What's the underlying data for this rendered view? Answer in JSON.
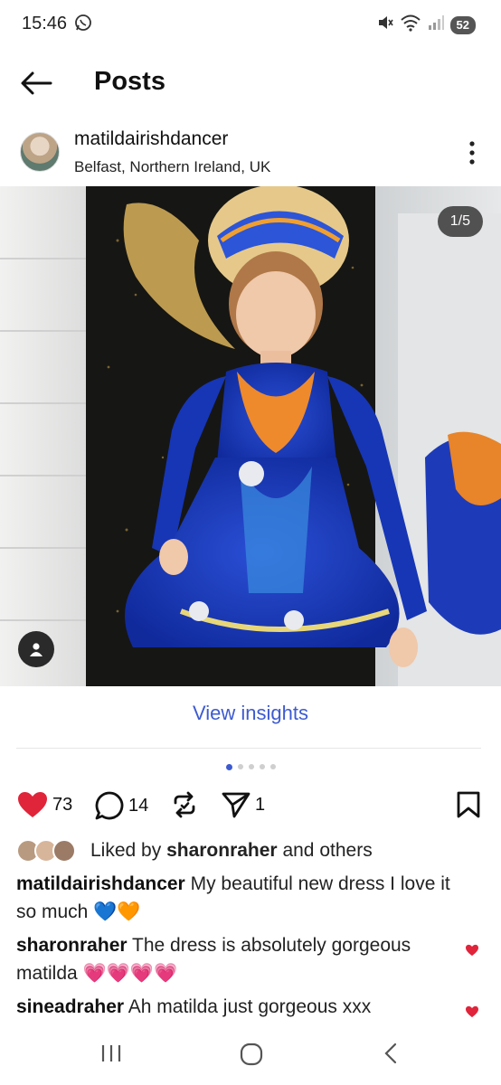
{
  "status": {
    "time": "15:46",
    "battery": "52"
  },
  "topbar": {
    "title": "Posts"
  },
  "post": {
    "username": "matildairishdancer",
    "location": "Belfast, Northern Ireland, UK",
    "image_counter": "1/5",
    "view_insights": "View insights",
    "pages": 5,
    "active_page": 1
  },
  "actions": {
    "likes": "73",
    "comments": "14",
    "shares": "1"
  },
  "liked_by": {
    "prefix": "Liked by ",
    "user": "sharonraher",
    "suffix": " and others"
  },
  "comments": [
    {
      "user": "matildairishdancer",
      "text": "My beautiful  new dress I love it so much 💙🧡",
      "liked": false
    },
    {
      "user": "sharonraher",
      "text": "The dress is absolutely gorgeous matilda 💗💗💗💗",
      "liked": true
    },
    {
      "user": "sineadraher",
      "text": "Ah matilda just gorgeous  xxx",
      "liked": true
    }
  ],
  "colors": {
    "accent": "#3d5bd0",
    "like_red": "#e0243a"
  }
}
